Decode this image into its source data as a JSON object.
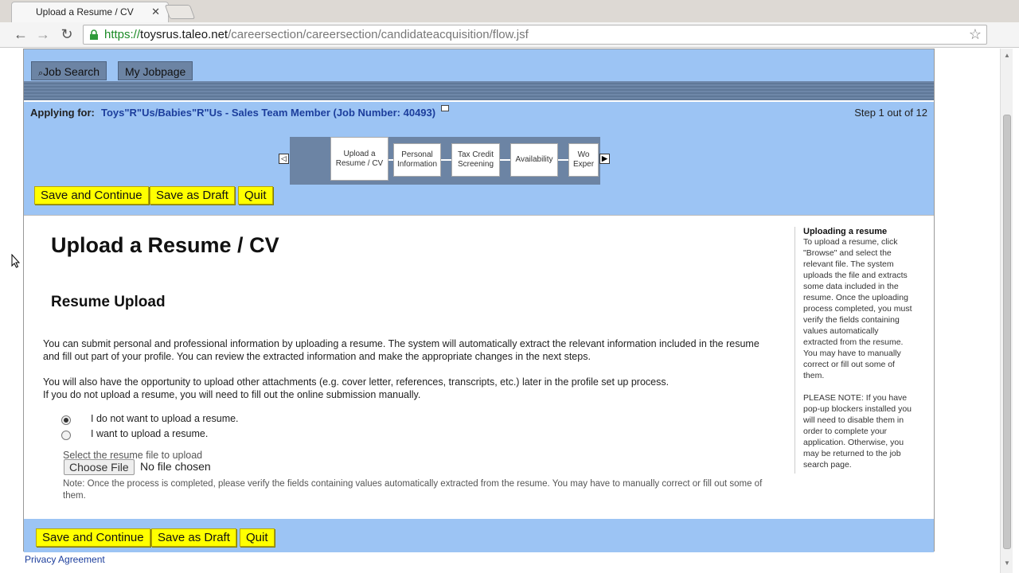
{
  "browser": {
    "tab_title": "Upload a Resume / CV",
    "url_scheme": "https://",
    "url_host": "toysrus.taleo.net",
    "url_path": "/careersection/careersection/candidateacquisition/flow.jsf"
  },
  "nav": {
    "job_search": "Job Search",
    "my_jobpage": "My Jobpage"
  },
  "apply": {
    "label": "Applying for:",
    "job": "Toys\"R\"Us/Babies\"R\"Us - Sales Team Member (Job Number: 40493)",
    "step": "Step 1 out of 12"
  },
  "steps": [
    {
      "label": "Upload a Resume / CV",
      "active": true
    },
    {
      "label": "Personal Information"
    },
    {
      "label": "Tax Credit Screening"
    },
    {
      "label": "Availability"
    },
    {
      "label": "Wo Exper"
    }
  ],
  "actions": {
    "save_continue": "Save and Continue",
    "save_draft": "Save as Draft",
    "quit": "Quit"
  },
  "main": {
    "title": "Upload a Resume / CV",
    "subtitle": "Resume Upload",
    "para1": "You can submit personal and professional information by uploading a resume. The system will automatically extract the relevant information included in the resume and fill out part of your profile. You can review the extracted information and make the appropriate changes in the next steps.",
    "para2a": "You will also have the opportunity to upload other attachments (e.g. cover letter, references, transcripts, etc.) later in the profile set up process.",
    "para2b": "If you do not upload a resume, you will need to fill out the online submission manually.",
    "radio1": "I do not want to upload a resume.",
    "radio2": "I want to upload a resume.",
    "select_label": "Select the resume file to upload",
    "choose_file": "Choose File",
    "no_file": "No file chosen",
    "note": "Note: Once the process is completed, please verify the fields containing values automatically extracted from the resume. You may have to manually correct or fill out some of them."
  },
  "sidebar": {
    "title": "Uploading a resume",
    "text1": "To upload a resume, click \"Browse\" and select the relevant file. The system uploads the file and extracts some data included in the resume. Once the uploading process completed, you must verify the fields containing values automatically extracted from the resume. You may have to manually correct or fill out some of them.",
    "text2": "PLEASE NOTE: If you have pop-up blockers installed you will need to disable them in order to complete your application. Otherwise, you may be returned to the job search page."
  },
  "footer": {
    "privacy": "Privacy Agreement"
  }
}
